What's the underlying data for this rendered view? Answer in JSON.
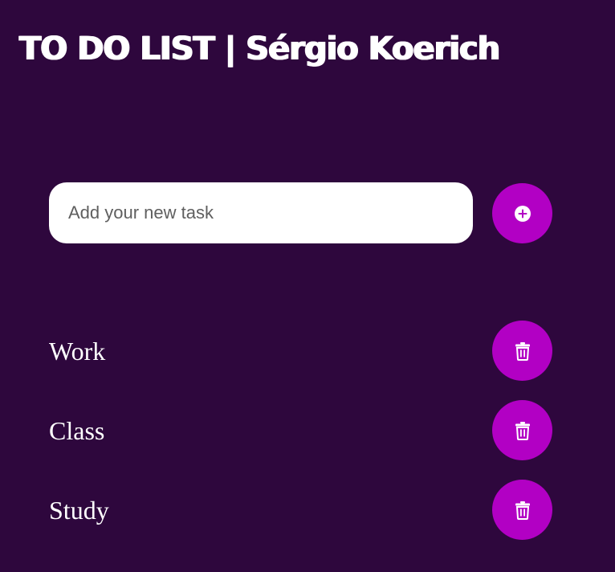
{
  "header": {
    "title": "TO DO LIST | Sérgio Koerich"
  },
  "new_task": {
    "placeholder": "Add your new task",
    "value": "",
    "add_icon": "plus-circle-icon"
  },
  "colors": {
    "background": "#2e073d",
    "accent": "#b200c4",
    "text": "#ffffff"
  },
  "tasks": [
    {
      "label": "Work",
      "action_icon": "trash-icon"
    },
    {
      "label": "Class",
      "action_icon": "trash-icon"
    },
    {
      "label": "Study",
      "action_icon": "trash-icon"
    }
  ]
}
